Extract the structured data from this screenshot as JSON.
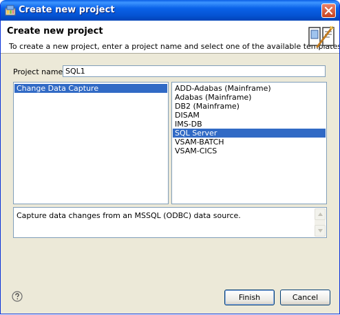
{
  "window": {
    "title": "Create new project",
    "close_icon": "close-icon",
    "app_icon": "project-app-icon"
  },
  "banner": {
    "title": "Create new project",
    "description": "To create a new project, enter a project name and select one of the available templates.",
    "icon": "wizard-wand-icon"
  },
  "project_name": {
    "label": "Project name:",
    "value": "SQL1"
  },
  "categories": [
    {
      "label": "Change Data Capture",
      "selected": true
    }
  ],
  "templates": [
    {
      "label": "ADD-Adabas (Mainframe)",
      "selected": false
    },
    {
      "label": "Adabas (Mainframe)",
      "selected": false
    },
    {
      "label": "DB2 (Mainframe)",
      "selected": false
    },
    {
      "label": "DISAM",
      "selected": false
    },
    {
      "label": "IMS-DB",
      "selected": false
    },
    {
      "label": "SQL Server",
      "selected": true
    },
    {
      "label": "VSAM-BATCH",
      "selected": false
    },
    {
      "label": "VSAM-CICS",
      "selected": false
    }
  ],
  "description_text": "Capture data changes from an MSSQL (ODBC) data source.",
  "buttons": {
    "finish": "Finish",
    "cancel": "Cancel"
  },
  "colors": {
    "selection": "#316ac5",
    "titlebar": "#0553d3",
    "dialog_bg": "#ece9d8"
  }
}
